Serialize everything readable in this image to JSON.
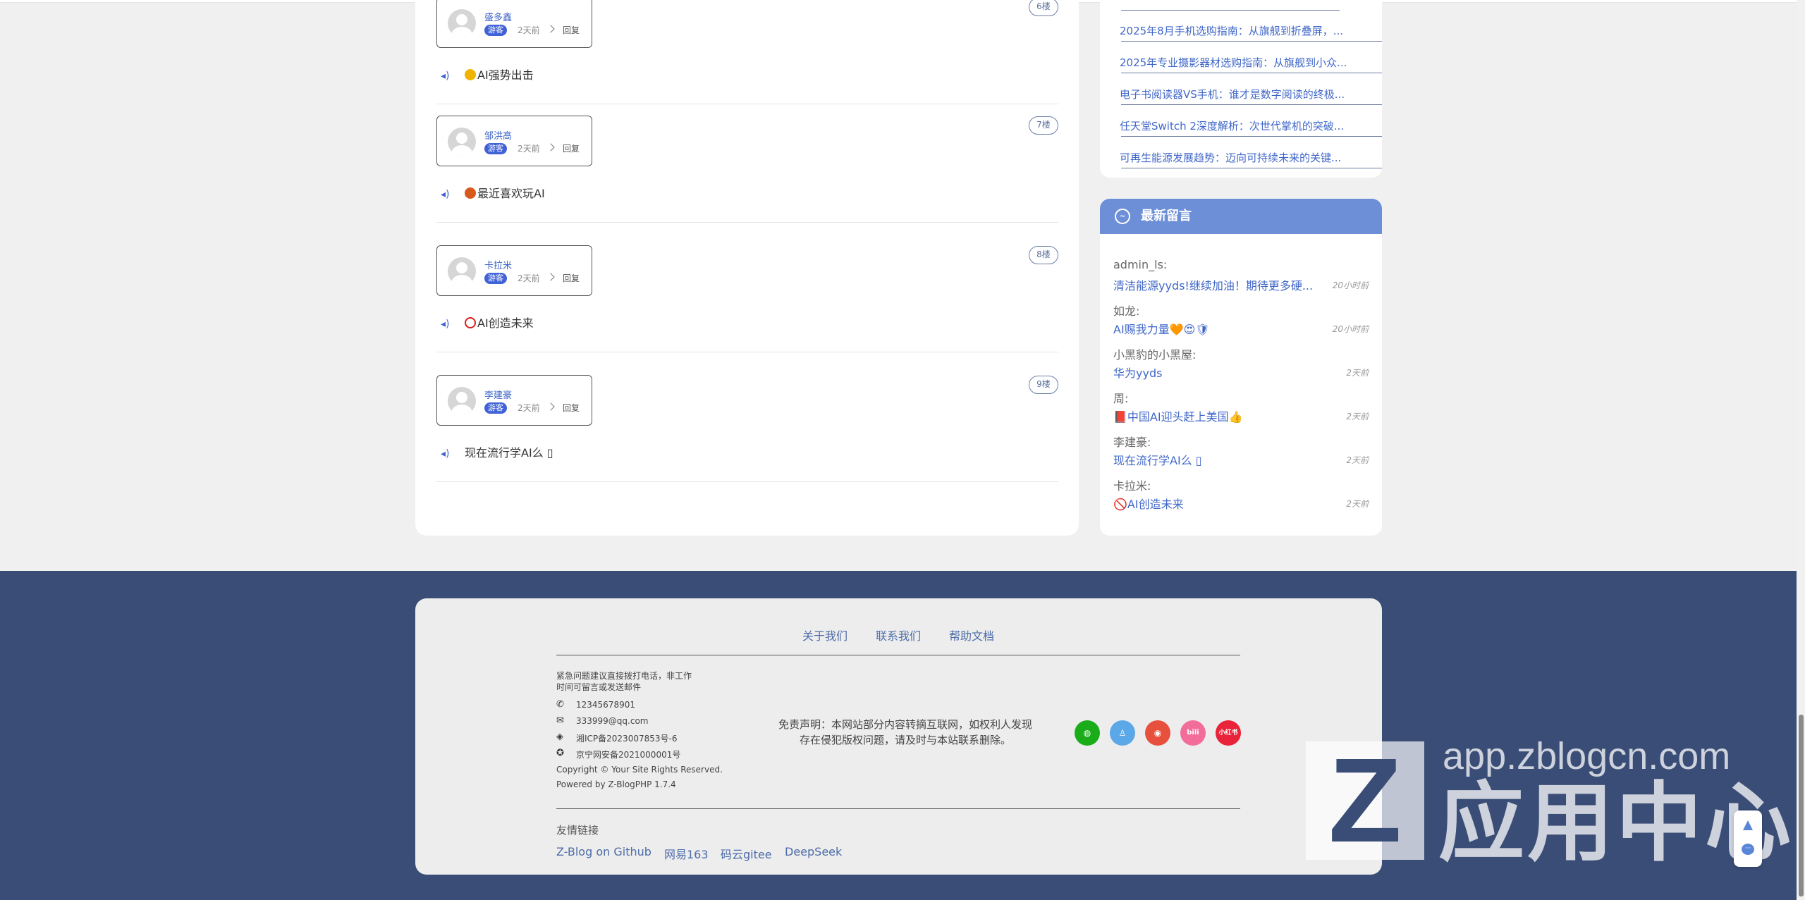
{
  "comments": [
    {
      "user": "盛多鑫",
      "role": "游客",
      "time": "2天前",
      "reply": "回复",
      "floor": "6楼",
      "emoji": "fist-emoji",
      "emoji_color": "#f0b400",
      "text": "AI强势出击"
    },
    {
      "user": "邹洪高",
      "role": "游客",
      "time": "2天前",
      "reply": "回复",
      "floor": "7楼",
      "emoji": "basketball-emoji",
      "emoji_color": "#d9581c",
      "text": "最近喜欢玩AI"
    },
    {
      "user": "卡拉米",
      "role": "游客",
      "time": "2天前",
      "reply": "回复",
      "floor": "8楼",
      "emoji": "prohibited-emoji",
      "emoji_color": "#d81e1e",
      "text": "AI创造未来"
    },
    {
      "user": "李建豪",
      "role": "游客",
      "time": "2天前",
      "reply": "回复",
      "floor": "9楼",
      "emoji": "",
      "emoji_color": "",
      "text": "现在流行学AI么 ▯"
    }
  ],
  "sidebar_articles": [
    "2025年8月手机选购指南：从旗舰到折叠屏，...",
    "2025年专业摄影器材选购指南：从旗舰到小众...",
    "电子书阅读器VS手机：谁才是数字阅读的终极...",
    "任天堂Switch 2深度解析：次世代掌机的突破...",
    "可再生能源发展趋势：迈向可持续未来的关键..."
  ],
  "latest_messages": {
    "title": "最新留言",
    "items": [
      {
        "author": "admin_ls:",
        "text": "清洁能源yyds!继续加油！期待更多硬...",
        "time": "20小时前"
      },
      {
        "author": "如龙:",
        "text": "AI赐我力量🧡😍🛡",
        "time": "20小时前"
      },
      {
        "author": "小黑豹的小黑屋:",
        "text": "华为yyds",
        "time": "2天前"
      },
      {
        "author": "周:",
        "text": "📕中国AI迎头赶上美国👍",
        "time": "2天前"
      },
      {
        "author": "李建豪:",
        "text": "现在流行学AI么 ▯",
        "time": "2天前"
      },
      {
        "author": "卡拉米:",
        "text": "🚫AI创造未来",
        "time": "2天前"
      }
    ]
  },
  "footer": {
    "nav": [
      "关于我们",
      "联系我们",
      "帮助文档"
    ],
    "notice": "紧急问题建议直接拨打电话，非工作时间可留言或发送邮件",
    "notice_line1": "紧急问题建议直接拨打电话，非工作",
    "notice_line2": "时间可留言或发送邮件",
    "phone": "12345678901",
    "email": "333999@qq.com",
    "icp": "湘ICP备2023007853号-6",
    "police": "京宁网安备2021000001号",
    "copyright": "Copyright © Your Site Rights Reserved.",
    "powered": "Powered by Z-BlogPHP 1.7.4",
    "disclaimer_line1": "免责声明：本网站部分内容转摘互联网，如权利人发现",
    "disclaimer_line2": "存在侵犯版权问题，请及时与本站联系删除。",
    "social": [
      {
        "name": "wechat-icon",
        "color": "#1aad19",
        "glyph": "💬"
      },
      {
        "name": "qq-icon",
        "color": "#5aa8e8",
        "glyph": "🐧"
      },
      {
        "name": "weibo-icon",
        "color": "#e6503c",
        "glyph": "微"
      },
      {
        "name": "bilibili-icon",
        "color": "#f26d9a",
        "glyph": "bili"
      },
      {
        "name": "xiaohongshu-icon",
        "color": "#e8233a",
        "glyph": "小红书"
      }
    ],
    "links_title": "友情链接",
    "links": [
      "Z-Blog on Github",
      "网易163",
      "码云gitee",
      "DeepSeek"
    ]
  },
  "watermark": {
    "url": "app.zblogcn.com",
    "text": "应用中心",
    "logo": "Z"
  }
}
